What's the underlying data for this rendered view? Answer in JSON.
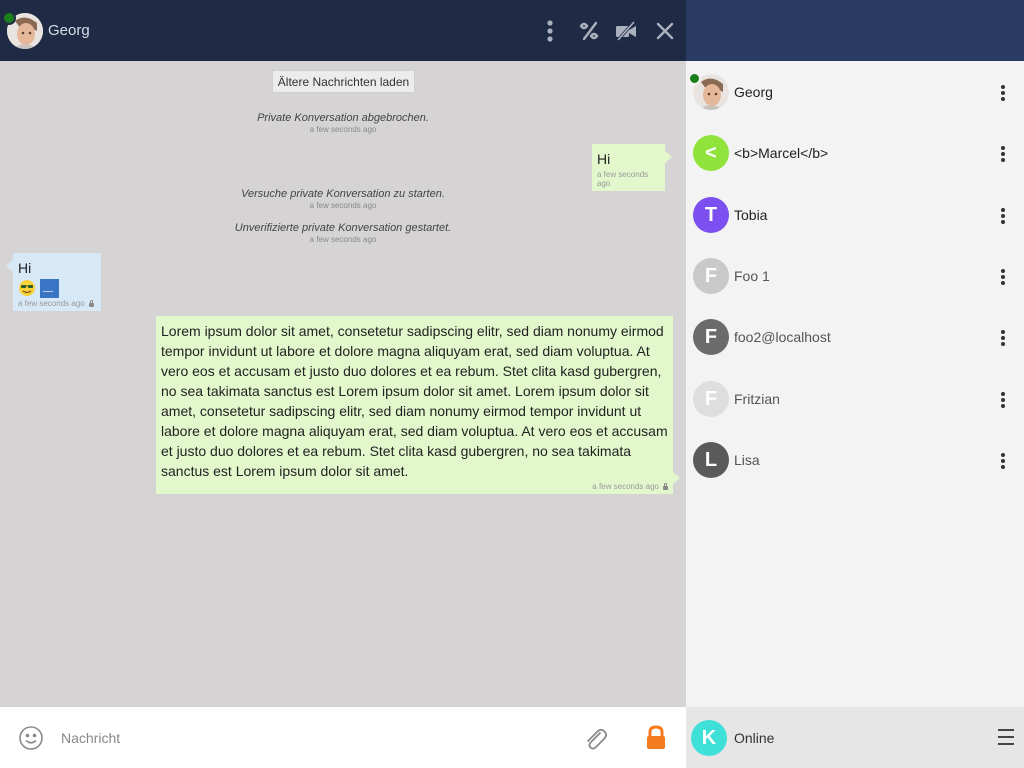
{
  "header": {
    "name": "Georg",
    "presence_color": "#1a7f1a",
    "icons": [
      "more-vertical-icon",
      "percent-icon",
      "video-off-icon",
      "close-icon"
    ]
  },
  "chat": {
    "load_older": "Ältere Nachrichten laden",
    "messages": [
      {
        "kind": "system",
        "text": "Private Konversation abgebrochen.",
        "time": "a few seconds ago"
      },
      {
        "kind": "out",
        "text": "Hi",
        "time": "a few seconds ago"
      },
      {
        "kind": "system",
        "text": "Versuche private Konversation zu starten.",
        "time": "a few seconds ago"
      },
      {
        "kind": "system",
        "text": "Unverifizierte private Konversation gestartet.",
        "time": "a few seconds ago"
      },
      {
        "kind": "in",
        "text": "Hi",
        "time": "a few seconds ago",
        "encrypted": true,
        "attachments": [
          "emoji-sunglasses",
          "image-thumbnail"
        ]
      },
      {
        "kind": "out",
        "text": "Lorem ipsum dolor sit amet, consetetur sadipscing elitr, sed diam nonumy eirmod tempor invidunt ut labore et dolore magna aliquyam erat, sed diam voluptua. At vero eos et accusam et justo duo dolores et ea rebum. Stet clita kasd gubergren, no sea takimata sanctus est Lorem ipsum dolor sit amet. Lorem ipsum dolor sit amet, consetetur sadipscing elitr, sed diam nonumy eirmod tempor invidunt ut labore et dolore magna aliquyam erat, sed diam voluptua. At vero eos et accusam et justo duo dolores et ea rebum. Stet clita kasd gubergren, no sea takimata sanctus est Lorem ipsum dolor sit amet.",
        "time": "a few seconds ago",
        "encrypted": true
      }
    ]
  },
  "input": {
    "placeholder": "Nachricht",
    "emoji_icon": "smiley-icon",
    "attach_icon": "paperclip-icon",
    "encryption_icon": "lock-icon",
    "encryption_color": "#f47c20"
  },
  "roster": {
    "contacts": [
      {
        "name": "Georg",
        "initial": "",
        "avatar_color": "#e8e3df",
        "online": true,
        "name_color": "#222"
      },
      {
        "name": "<b>Marcel</b>",
        "initial": "<",
        "avatar_color": "#8fe33b",
        "online": false,
        "name_color": "#222"
      },
      {
        "name": "Tobia",
        "initial": "T",
        "avatar_color": "#7c4ff0",
        "online": false,
        "name_color": "#222"
      },
      {
        "name": "Foo 1",
        "initial": "F",
        "avatar_color": "#c9c9c9",
        "online": false,
        "name_color": "#555"
      },
      {
        "name": "foo2@localhost",
        "initial": "F",
        "avatar_color": "#6b6b6b",
        "online": false,
        "name_color": "#555"
      },
      {
        "name": "Fritzian",
        "initial": "F",
        "avatar_color": "#dedede",
        "online": false,
        "name_color": "#555"
      },
      {
        "name": "Lisa",
        "initial": "L",
        "avatar_color": "#5a5a5a",
        "online": false,
        "name_color": "#555"
      }
    ]
  },
  "footer": {
    "initial": "K",
    "avatar_color": "#3fe0d8",
    "status": "Online",
    "menu_icon": "hamburger-menu-icon"
  }
}
